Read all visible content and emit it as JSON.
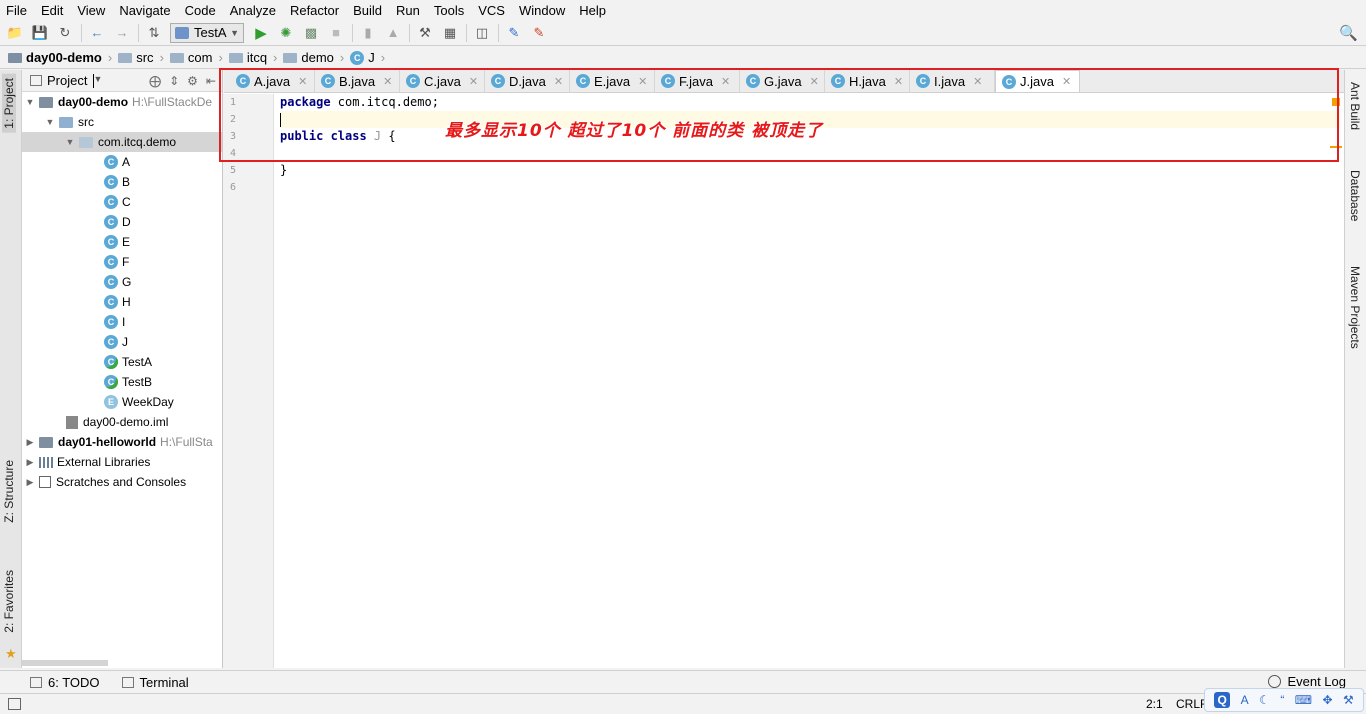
{
  "menu": [
    "File",
    "Edit",
    "View",
    "Navigate",
    "Code",
    "Analyze",
    "Refactor",
    "Build",
    "Run",
    "Tools",
    "VCS",
    "Window",
    "Help"
  ],
  "toolbar": {
    "run_config": "TestA"
  },
  "breadcrumbs": [
    "day00-demo",
    "src",
    "com",
    "itcq",
    "demo",
    "J"
  ],
  "left_tabs": {
    "project": "1: Project",
    "structure": "Z: Structure",
    "favorites": "2: Favorites"
  },
  "right_tabs": [
    "Ant Build",
    "Database",
    "Maven Projects"
  ],
  "project_panel": {
    "title": "Project",
    "tree": {
      "root": {
        "name": "day00-demo",
        "path": "H:\\FullStackDe"
      },
      "src": "src",
      "package": "com.itcq.demo",
      "classes": [
        "A",
        "B",
        "C",
        "D",
        "E",
        "F",
        "G",
        "H",
        "I",
        "J"
      ],
      "runnable": [
        "TestA",
        "TestB"
      ],
      "enum": "WeekDay",
      "iml": "day00-demo.iml",
      "module2": {
        "name": "day01-helloworld",
        "path": "H:\\FullSta"
      },
      "ext": "External Libraries",
      "scratch": "Scratches and Consoles"
    }
  },
  "editor": {
    "tabs": [
      "A.java",
      "B.java",
      "C.java",
      "D.java",
      "E.java",
      "F.java",
      "G.java",
      "H.java",
      "I.java",
      "J.java"
    ],
    "active_tab": "J.java",
    "line_numbers": [
      "1",
      "2",
      "3",
      "4",
      "5",
      "6"
    ],
    "code": {
      "l1_kw": "package",
      "l1_rest": " com.itcq.demo;",
      "l3_kw": "public class",
      "l3_name": " J",
      "l3_rest": " {",
      "l5": "}"
    },
    "annotation": "最多显示10个 超过了10个 前面的类 被顶走了"
  },
  "bottom": {
    "todo": "6: TODO",
    "terminal": "Terminal",
    "event_log": "Event Log"
  },
  "status": {
    "position": "2:1",
    "line_sep": "CRLF"
  },
  "ime": {
    "q": "Q",
    "a": "A"
  }
}
